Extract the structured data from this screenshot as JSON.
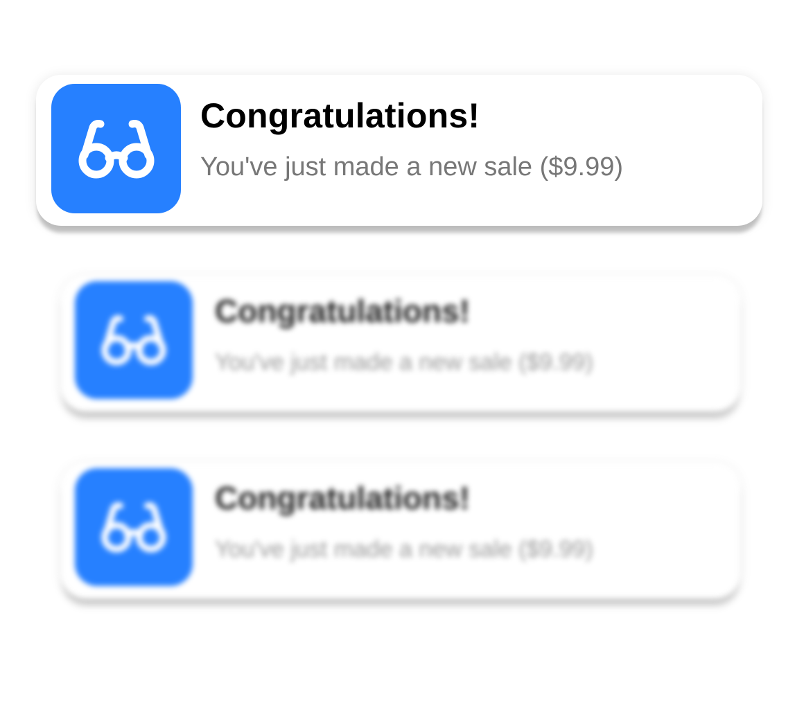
{
  "accent_color": "#2680FF",
  "notifications": [
    {
      "icon": "glasses-icon",
      "title": "Congratulations!",
      "message": "You've just made a new sale ($9.99)",
      "focused": true
    },
    {
      "icon": "glasses-icon",
      "title": "Congratulations!",
      "message": "You've just made a new sale ($9.99)",
      "focused": false
    },
    {
      "icon": "glasses-icon",
      "title": "Congratulations!",
      "message": "You've just made a new sale ($9.99)",
      "focused": false
    }
  ]
}
